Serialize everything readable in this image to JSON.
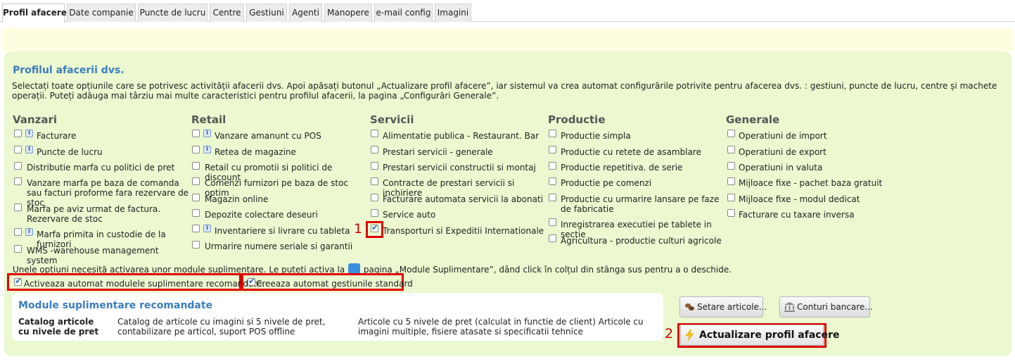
{
  "tabs": [
    {
      "label": "Profil afacere",
      "active": true
    },
    {
      "label": "Date companie"
    },
    {
      "label": "Puncte de lucru"
    },
    {
      "label": "Centre"
    },
    {
      "label": "Gestiuni"
    },
    {
      "label": "Agenti"
    },
    {
      "label": "Manopere"
    },
    {
      "label": "e-mail config"
    },
    {
      "label": "Imagini"
    }
  ],
  "profile": {
    "title": "Profilul afacerii dvs.",
    "intro": "Selectați toate opțiunile care se potrivesc activității afacerii dvs. Apoi apăsați butonul „Actualizare profil afacere”, iar sistemul va crea automat configurările potrivite pentru afacerea dvs. : gestiuni, puncte de lucru, centre și machete operații. Puteți adăuga mai târziu mai multe caracteristici pentru profilul afacerii, la pagina „Configurări Generale”."
  },
  "columns": [
    {
      "heading": "Vanzari",
      "options": [
        {
          "label": "Facturare",
          "checked": false,
          "info": true
        },
        {
          "label": "Puncte de lucru",
          "checked": false,
          "info": true
        },
        {
          "label": "Distributie marfa cu politici de pret",
          "checked": false
        },
        {
          "label": "Vanzare marfa pe baza de comanda sau facturi proforme fara rezervare de stoc",
          "checked": false
        },
        {
          "label": "Marfa pe aviz urmat de factura. Rezervare de stoc",
          "checked": false
        },
        {
          "label": "Marfa primita in custodie de la furnizori",
          "checked": false,
          "info": true
        },
        {
          "label": "WMS -warehouse management system",
          "checked": false
        }
      ]
    },
    {
      "heading": "Retail",
      "options": [
        {
          "label": "Vanzare amanunt cu POS",
          "checked": false,
          "info": true
        },
        {
          "label": "Retea de magazine",
          "checked": false,
          "info": true
        },
        {
          "label": "Retail cu promotii si politici de discount",
          "checked": false
        },
        {
          "label": "Comenzi furnizori pe baza de stoc optim",
          "checked": false
        },
        {
          "label": "Magazin online",
          "checked": false
        },
        {
          "label": "Depozite colectare deseuri",
          "checked": false
        },
        {
          "label": "Inventariere si livrare cu tableta",
          "checked": false,
          "info": true
        },
        {
          "label": "Urmarire numere seriale si garantii",
          "checked": false
        }
      ]
    },
    {
      "heading": "Servicii",
      "options": [
        {
          "label": "Alimentatie publica - Restaurant. Bar",
          "checked": false
        },
        {
          "label": "Prestari servicii - generale",
          "checked": false
        },
        {
          "label": "Prestari servicii constructii si montaj",
          "checked": false
        },
        {
          "label": "Contracte de prestari servicii si inchiriere",
          "checked": false
        },
        {
          "label": "Facturare automata servicii la abonati",
          "checked": false
        },
        {
          "label": "Service auto",
          "checked": false
        },
        {
          "label": "Transporturi si Expeditii Internationale",
          "checked": true
        }
      ]
    },
    {
      "heading": "Productie",
      "options": [
        {
          "label": "Productie simpla",
          "checked": false
        },
        {
          "label": "Productie cu retete de asamblare",
          "checked": false
        },
        {
          "label": "Productie repetitiva. de serie",
          "checked": false
        },
        {
          "label": "Productie pe comenzi",
          "checked": false
        },
        {
          "label": "Productie cu urmarire lansare pe faze de fabricatie",
          "checked": false
        },
        {
          "label": "Inregistrarea executiei pe tablete in sectie",
          "checked": false
        },
        {
          "label": "Agricultura - productie culturi agricole",
          "checked": false
        }
      ]
    },
    {
      "heading": "Generale",
      "options": [
        {
          "label": "Operatiuni de import",
          "checked": false
        },
        {
          "label": "Operatiuni de export",
          "checked": false
        },
        {
          "label": "Operatiuni in valuta",
          "checked": false
        },
        {
          "label": "Mijloace fixe - pachet baza gratuit",
          "checked": false
        },
        {
          "label": "Mijloace fixe - modul dedicat",
          "checked": false
        },
        {
          "label": "Facturare cu taxare inversa",
          "checked": false
        }
      ]
    }
  ],
  "note": {
    "before": "Unele opțiuni necesită activarea unor module suplimentare. Le puteți activa la",
    "after": "pagina „Module Suplimentare”, dând click în colțul din stânga sus pentru a o deschide."
  },
  "auto_options": [
    {
      "label": "Activeaza automat modulele suplimentare recomandate.",
      "checked": true
    },
    {
      "label": "Creeaza automat gestiunile standard",
      "checked": true
    }
  ],
  "recommended": {
    "title": "Module suplimentare recomandate",
    "name": "Catalog articole cu nivele de pret",
    "summary": "Catalog de articole cu imagini si 5 nivele de pret, contabilizare pe articol, suport POS offline",
    "details": "Articole cu 5 nivele de pret (calculat in functie de client) Articole cu imagini multiple, fisiere atasate si specificatii tehnice"
  },
  "buttons": {
    "setare": "Setare articole...",
    "conturi": "Conturi bancare...",
    "actualizare": "Actualizare profil afacere"
  },
  "annotations": [
    "1",
    "2"
  ],
  "colors": {
    "accent": "#3b7dbf",
    "panel": "#ebf8d0",
    "infobar": "#fffde0",
    "highlight": "#e00000"
  }
}
